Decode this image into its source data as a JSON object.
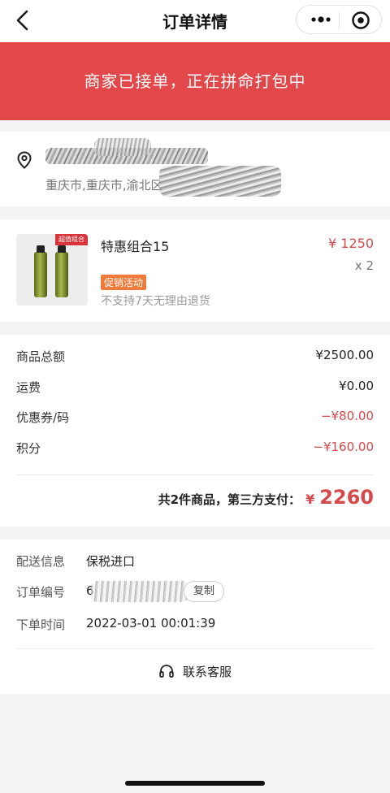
{
  "nav": {
    "title": "订单详情",
    "back_icon": "chevron-left-icon",
    "more_icon": "more-dots-icon",
    "close_icon": "target-close-icon"
  },
  "status_banner": {
    "text": "商家已接单，正在拼命打包中",
    "color": "#e2484a"
  },
  "address": {
    "icon": "location-pin-icon",
    "city_text": "重庆市,重庆市,渝北区"
  },
  "product": {
    "badge": "超值组合",
    "name": "特惠组合15",
    "price": "¥ 1250",
    "quantity": "x 2",
    "promo_tag": "促销活动",
    "return_policy": "不支持7天无理由退货"
  },
  "summary": {
    "rows": [
      {
        "label": "商品总额",
        "value": "¥2500.00"
      },
      {
        "label": "运费",
        "value": "¥0.00"
      },
      {
        "label": "优惠券/码",
        "value": "−¥80.00"
      },
      {
        "label": "积分",
        "value": "−¥160.00"
      }
    ],
    "total_prefix": "共2件商品，第三方支付：",
    "total_currency": "¥",
    "total_amount": "2260",
    "accent_color": "#d7484a"
  },
  "order_info": {
    "delivery_label": "配送信息",
    "delivery_value": "保税进口",
    "order_no_label": "订单编号",
    "order_no_visible": "6",
    "copy_button": "复制",
    "time_label": "下单时间",
    "time_value": "2022-03-01 00:01:39"
  },
  "service": {
    "icon": "headset-icon",
    "label": "联系客服"
  }
}
